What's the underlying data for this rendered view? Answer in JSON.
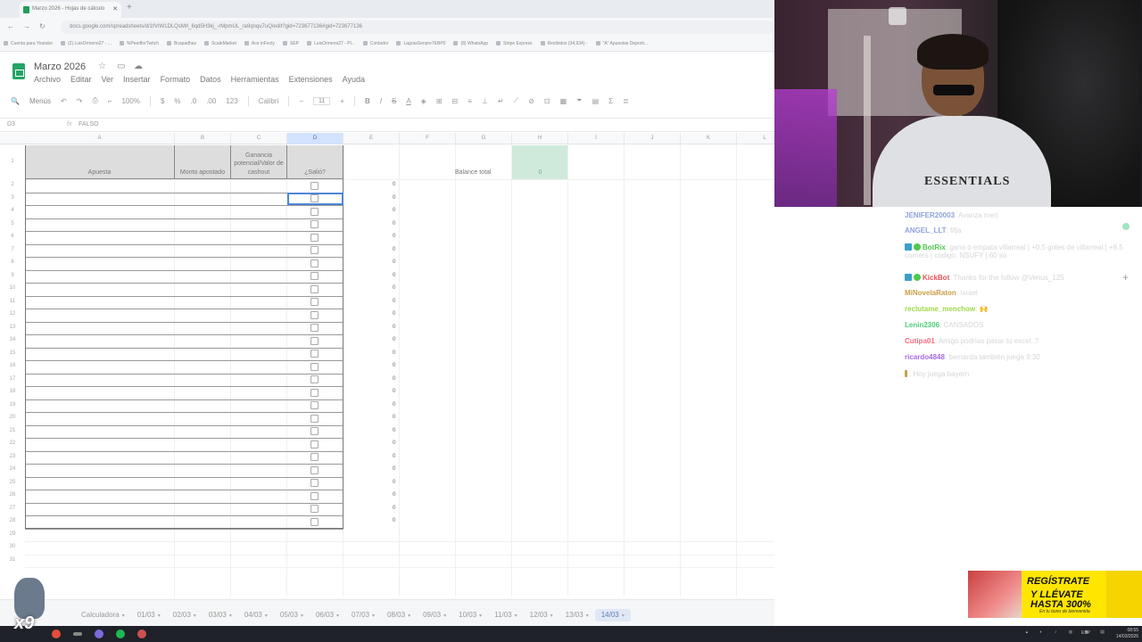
{
  "browser": {
    "tab_title": "Marzo 2026 - Hojas de cálculo",
    "new_tab": "+",
    "url": "docs.google.com/spreadsheets/d/1fVrW1DLQsMrl_6qd5H3kj_-rMpmUL_ra9qnqu7uQ/edit?gid=723677136#gid=723677136",
    "bookmarks": [
      "Cuenta para Youtube",
      "(2) LuisOrmeno27 - ...",
      "%PeedforTwitch",
      "Bcapadhas",
      "ScaleMarket",
      "Ace inFecty",
      "SEP",
      "LuisOrmeno27 - Pl...",
      "Contador",
      "LagrasSenpre7EBP0",
      "(8) WhatsApp",
      "Stripe Express",
      "Recibidos (34,934) -",
      "\"A\" Apuestas Deporti..."
    ]
  },
  "doc": {
    "title": "Marzo 2026",
    "menu": [
      "Archivo",
      "Editar",
      "Ver",
      "Insertar",
      "Formato",
      "Datos",
      "Herramientas",
      "Extensiones",
      "Ayuda"
    ],
    "toolbar": {
      "menus": "Menús",
      "zoom": "100%",
      "currency": "$",
      "percent": "%",
      "number_format": "123",
      "font": "Calibri",
      "font_size": "11"
    },
    "namebox": "D3",
    "fx": "fx",
    "formula_value": "FALSO"
  },
  "grid": {
    "columns": [
      "A",
      "B",
      "C",
      "D",
      "E",
      "F",
      "G",
      "H",
      "I",
      "J",
      "K",
      "L"
    ],
    "rows": [
      "1",
      "2",
      "3",
      "4",
      "5",
      "6",
      "7",
      "8",
      "9",
      "10",
      "11",
      "12",
      "13",
      "14",
      "15",
      "16",
      "17",
      "18",
      "19",
      "20",
      "21",
      "22",
      "23",
      "24",
      "25",
      "26",
      "27",
      "28",
      "29",
      "30",
      "31"
    ],
    "headers": {
      "apuesta": "Apuesta",
      "monto": "Monto apostado",
      "ganancia": "Ganancia potencial/Valor de cashout",
      "salio": "¿Salió?"
    },
    "e_values": [
      "0",
      "0",
      "0",
      "0",
      "0",
      "0",
      "0",
      "0",
      "0",
      "0",
      "0",
      "0",
      "0",
      "0",
      "0",
      "0",
      "0",
      "0",
      "0",
      "0",
      "0",
      "0",
      "0",
      "0",
      "0",
      "0",
      "0"
    ],
    "balance_label": "Balance total",
    "balance_value": "0"
  },
  "sheets": [
    "Calculadora",
    "01/03",
    "02/03",
    "03/03",
    "04/03",
    "05/03",
    "06/03",
    "07/03",
    "08/03",
    "09/03",
    "10/03",
    "11/03",
    "12/03",
    "13/03",
    "14/03"
  ],
  "active_sheet": "14/03",
  "chat": [
    {
      "user": "JENIFER20003",
      "text": ": Avanza meri",
      "color": "#8fa3d9"
    },
    {
      "user": "ANGEL_LLT",
      "text": ": fifja",
      "color": "#8fa3d9"
    },
    {
      "user": "BotRix",
      "text": ": gana o empata villarreal | +0.5 goles de villarreal | +8.5 corners | codigo: NSUFY | 60 so",
      "color": "#4ec94e",
      "badges": true
    },
    {
      "user": "KickBot",
      "text": ": Thanks for the follow @Venus_125",
      "color": "#e8505b",
      "badges": true
    },
    {
      "user": "MiNovelaRaton",
      "text": ": Israel",
      "color": "#c9a047"
    },
    {
      "user": "reclutame_menchow",
      "text": ": 🙌",
      "color": "#9fd94a"
    },
    {
      "user": "Lenin2306",
      "text": ": CANSADOS",
      "color": "#4ecf7a"
    },
    {
      "user": "Cutipa01",
      "text": ": Amigo podrías pasar tu excel..?",
      "color": "#ff6a7d"
    },
    {
      "user": "ricardo4848",
      "text": ": bernarda también juega 9:30",
      "color": "#a86ae8"
    },
    {
      "user": "",
      "text": ": Hoy juega bayern",
      "color": "#c9a047"
    }
  ],
  "shirt_text": "ESSENTIALS",
  "ad": {
    "line1": "REGÍSTRATE",
    "line2": "Y LLÉVATE",
    "line3": "HASTA 300%",
    "line4": "En tu bono de bienvenida"
  },
  "mascot_text": "x9",
  "taskbar": {
    "time": "08:55",
    "date": "14/03/2026",
    "lang": "ESP"
  }
}
